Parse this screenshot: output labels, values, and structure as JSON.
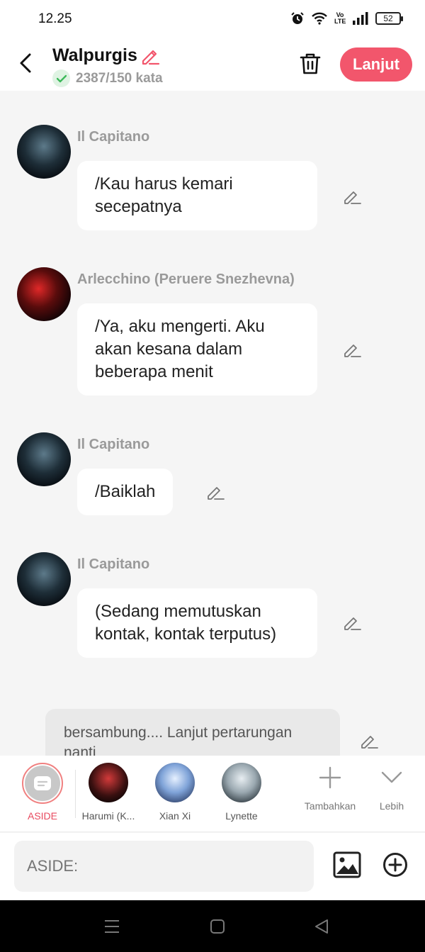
{
  "status_bar": {
    "time": "12.25",
    "battery": "52",
    "network": "Vo LTE"
  },
  "header": {
    "title": "Walpurgis",
    "word_count": "2387/150 kata",
    "next_label": "Lanjut"
  },
  "messages": [
    {
      "sender": "Il Capitano",
      "text": "/Kau harus kemari secepatnya"
    },
    {
      "sender": "Arlecchino (Peruere Snezhevna)",
      "text": "/Ya, aku mengerti. Aku akan kesana dalam beberapa menit"
    },
    {
      "sender": "Il Capitano",
      "text": "/Baiklah"
    },
    {
      "sender": "Il Capitano",
      "text": "(Sedang memutuskan kontak, kontak terputus)"
    }
  ],
  "narration": {
    "text": "bersambung.... Lanjut pertarungan nanti"
  },
  "character_bar": {
    "aside_label": "ASIDE",
    "characters": [
      {
        "name": "Harumi (K..."
      },
      {
        "name": "Xian Xi"
      },
      {
        "name": "Lynette"
      }
    ],
    "add_label": "Tambahkan",
    "more_label": "Lebih"
  },
  "input": {
    "placeholder": "ASIDE:"
  },
  "colors": {
    "accent": "#f2566c",
    "aside_text": "#e84a5f",
    "check_green": "#3cb95a"
  }
}
